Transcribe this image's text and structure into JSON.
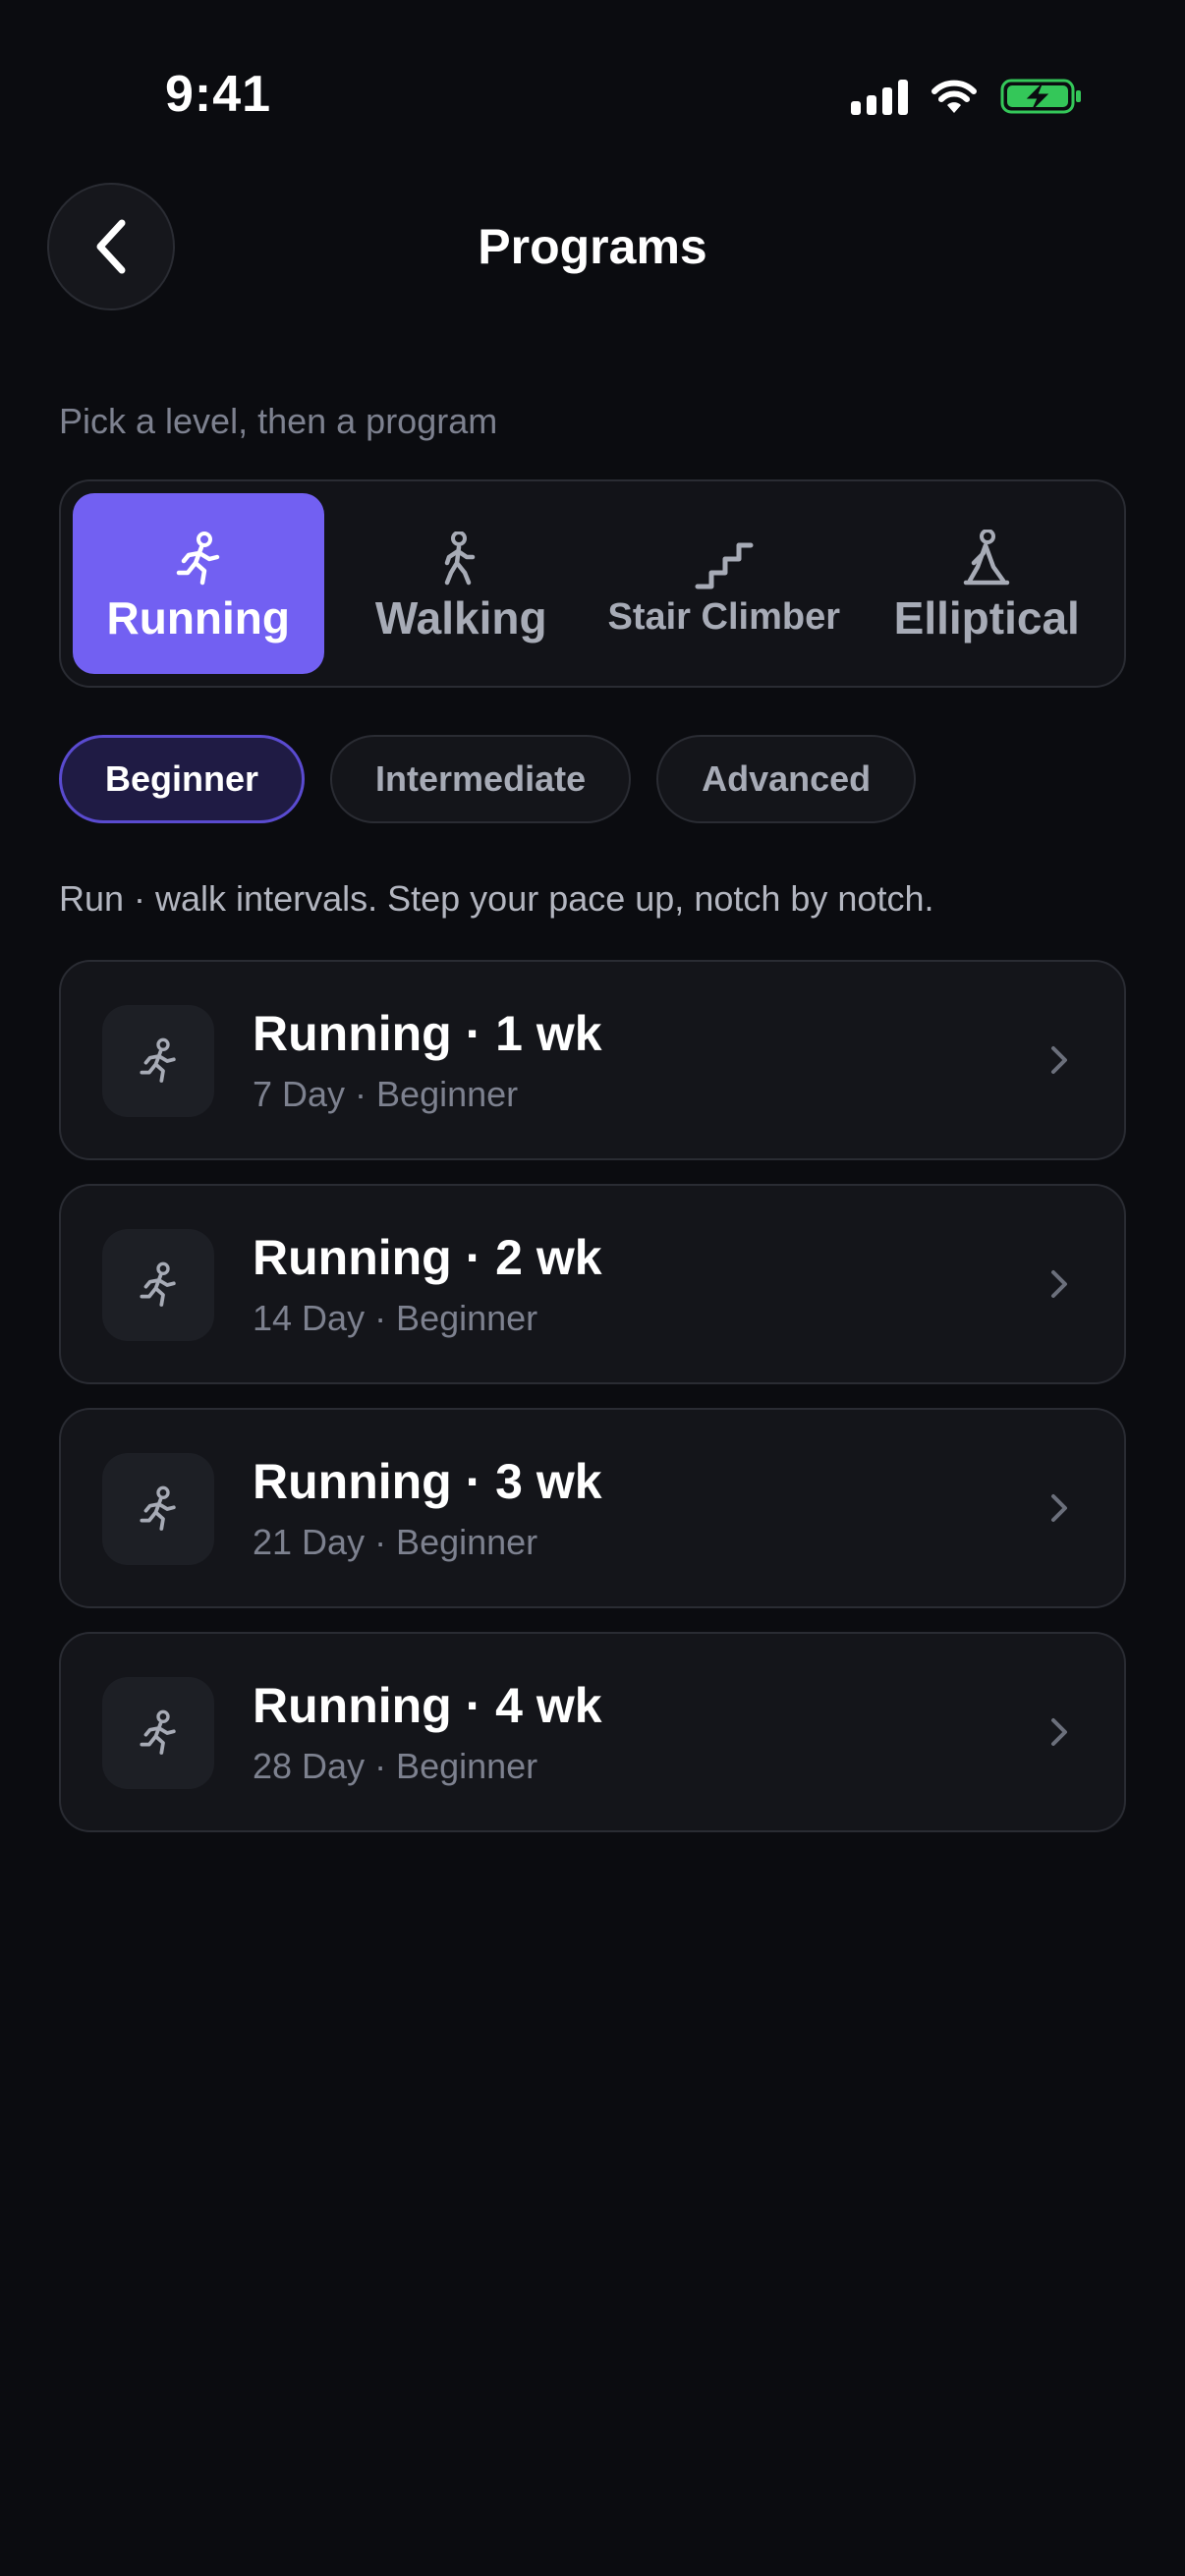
{
  "status_bar": {
    "time": "9:41"
  },
  "header": {
    "title": "Programs"
  },
  "hint": "Pick a level, then a program",
  "activities": [
    {
      "label": "Running",
      "icon": "running-icon",
      "active": true
    },
    {
      "label": "Walking",
      "icon": "walking-icon",
      "active": false
    },
    {
      "label": "Stair Climber",
      "icon": "stairs-icon",
      "active": false
    },
    {
      "label": "Elliptical",
      "icon": "elliptical-icon",
      "active": false
    }
  ],
  "levels": [
    {
      "label": "Beginner",
      "active": true
    },
    {
      "label": "Intermediate",
      "active": false
    },
    {
      "label": "Advanced",
      "active": false
    }
  ],
  "description": "Run · walk intervals. Step your pace up, notch by notch.",
  "programs": [
    {
      "title": "Running · 1 wk",
      "subtitle": "7 Day · Beginner"
    },
    {
      "title": "Running · 2 wk",
      "subtitle": "14 Day · Beginner"
    },
    {
      "title": "Running · 3 wk",
      "subtitle": "21 Day · Beginner"
    },
    {
      "title": "Running · 4 wk",
      "subtitle": "28 Day · Beginner"
    }
  ],
  "colors": {
    "accent": "#7260f2",
    "background": "#0b0c10",
    "card": "#14151a",
    "battery": "#34c759"
  }
}
